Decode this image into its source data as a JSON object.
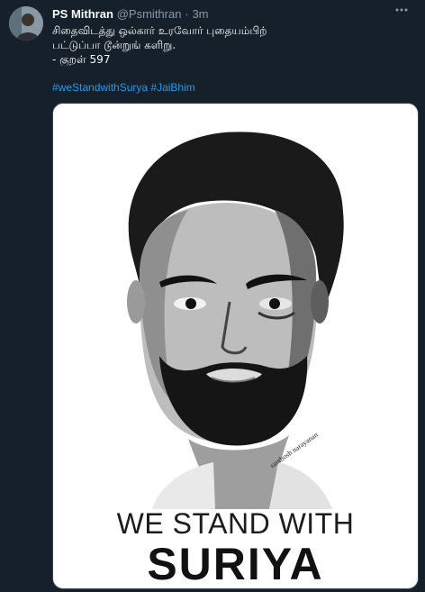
{
  "user": {
    "display_name": "PS Mithran",
    "handle": "@Psmithran",
    "separator": "·",
    "time": "3m"
  },
  "tweet": {
    "lines": [
      "சிதைவிடத்து ஒல்கார் உரவோர் புதையம்பிற்",
      "பட்டுப்பா டூன்றுங் களிறு.",
      "- குறள் 597"
    ],
    "hashtags": [
      "#weStandwithSurya",
      "#JaiBhim"
    ]
  },
  "icons": {
    "more": "more-options-icon"
  },
  "media": {
    "poster_line1": "WE STAND WITH",
    "poster_line2": "SURIYA",
    "signature": "santhosh narayanan"
  },
  "colors": {
    "background": "#15202b",
    "link": "#1d9bf0",
    "muted": "#8b98a5"
  }
}
